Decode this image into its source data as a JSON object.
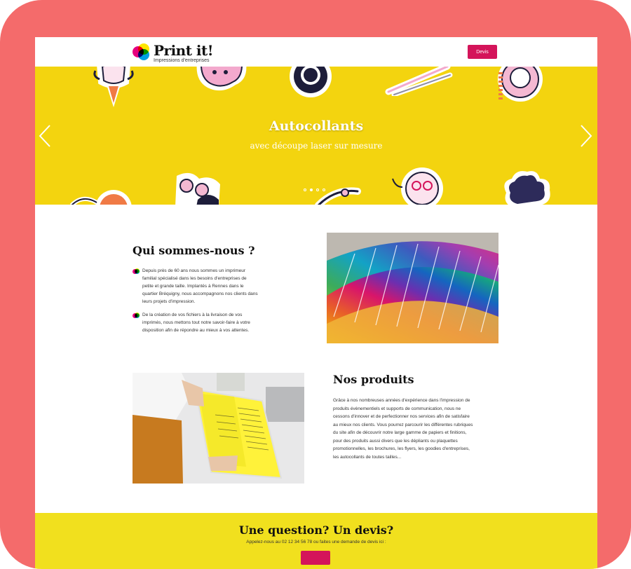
{
  "brand": {
    "name": "Print it!",
    "tagline": "Impressions d'entreprises",
    "colors": {
      "magenta": "#e6007e",
      "yellow": "#ffe600",
      "cyan": "#00a0e3",
      "button": "#d4145a",
      "hero_bg": "#f3d40f",
      "frame": "#f46b6b"
    }
  },
  "header": {
    "devis_label": "Devis"
  },
  "hero": {
    "title": "Autocollants",
    "subtitle": "avec découpe laser sur mesure",
    "prev_icon": "chevron-left-icon",
    "next_icon": "chevron-right-icon",
    "slides": [
      {
        "active": false
      },
      {
        "active": true
      },
      {
        "active": false
      },
      {
        "active": false
      }
    ]
  },
  "about": {
    "title": "Qui sommes-nous ?",
    "items": [
      "Depuis près de 60 ans nous sommes un imprimeur familial spécialisé dans les besoins d'entreprises de petite et grande taille. Implantés à Rennes dans le quartier Bréquigny, nous accompagnons nos clients dans leurs projets d'impression.",
      "De la création de vos fichiers à la livraison de vos imprimés, nous mettons tout notre savoir-faire à votre disposition afin de répondre au mieux à vos attentes."
    ]
  },
  "products": {
    "title": "Nos produits",
    "text": "Grâce à nos nombreuses années d'expérience dans l'impression de produits évènementiels et supports de communication, nous ne cessons d'innover et de perfectionner nos services afin de satisfaire au mieux nos clients. Vous pourrez parcourir les différentes rubriques du site afin de découvrir notre large gamme de papiers et finitions, pour des produits aussi divers que les dépliants ou plaquettes promotionnelles, les brochures, les flyers, les goodies d'entreprises, les autocollants de toutes tailles..."
  },
  "cta": {
    "title": "Une question? Un devis?",
    "text": "Appelez-nous au 02 12 34 56 78 ou faites une demande de devis ici :"
  }
}
